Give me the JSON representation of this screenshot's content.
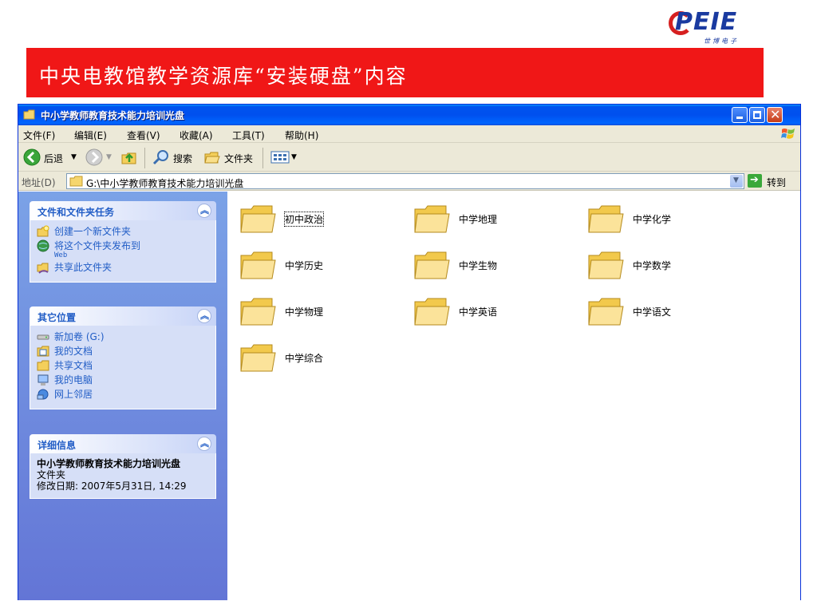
{
  "logo": {
    "brand": "PEIE",
    "subtitle": "世博电子"
  },
  "banner": {
    "title": "中央电教馆教学资源库“安装硬盘”内容"
  },
  "window": {
    "title": "中小学教师教育技术能力培训光盘",
    "menu": [
      "文件(F)",
      "编辑(E)",
      "查看(V)",
      "收藏(A)",
      "工具(T)",
      "帮助(H)"
    ],
    "toolbar": {
      "back": "后退",
      "search": "搜索",
      "folders": "文件夹"
    },
    "address": {
      "label": "地址(D)",
      "path": "G:\\中小学教师教育技术能力培训光盘",
      "go": "转到"
    }
  },
  "sidebar": {
    "file_tasks": {
      "title": "文件和文件夹任务",
      "items": [
        {
          "label": "创建一个新文件夹",
          "icon": "new-folder-icon"
        },
        {
          "label": "将这个文件夹发布到",
          "sub": "Web",
          "icon": "publish-web-icon"
        },
        {
          "label": "共享此文件夹",
          "icon": "share-folder-icon"
        }
      ]
    },
    "other_places": {
      "title": "其它位置",
      "items": [
        {
          "label": "新加卷 (G:)",
          "icon": "drive-icon"
        },
        {
          "label": "我的文档",
          "icon": "my-documents-icon"
        },
        {
          "label": "共享文档",
          "icon": "shared-documents-icon"
        },
        {
          "label": "我的电脑",
          "icon": "my-computer-icon"
        },
        {
          "label": "网上邻居",
          "icon": "network-icon"
        }
      ]
    },
    "details": {
      "title": "详细信息",
      "name": "中小学教师教育技术能力培训光盘",
      "type": "文件夹",
      "modified": "修改日期: 2007年5月31日, 14:29"
    }
  },
  "folders": [
    "初中政治",
    "中学地理",
    "中学化学",
    "中学历史",
    "中学生物",
    "中学数学",
    "中学物理",
    "中学英语",
    "中学语文",
    "中学综合"
  ],
  "colors": {
    "banner": "#f01717",
    "titlebar": "#0054e3",
    "taskpane": "#6f8ee0",
    "link": "#215dc6"
  }
}
